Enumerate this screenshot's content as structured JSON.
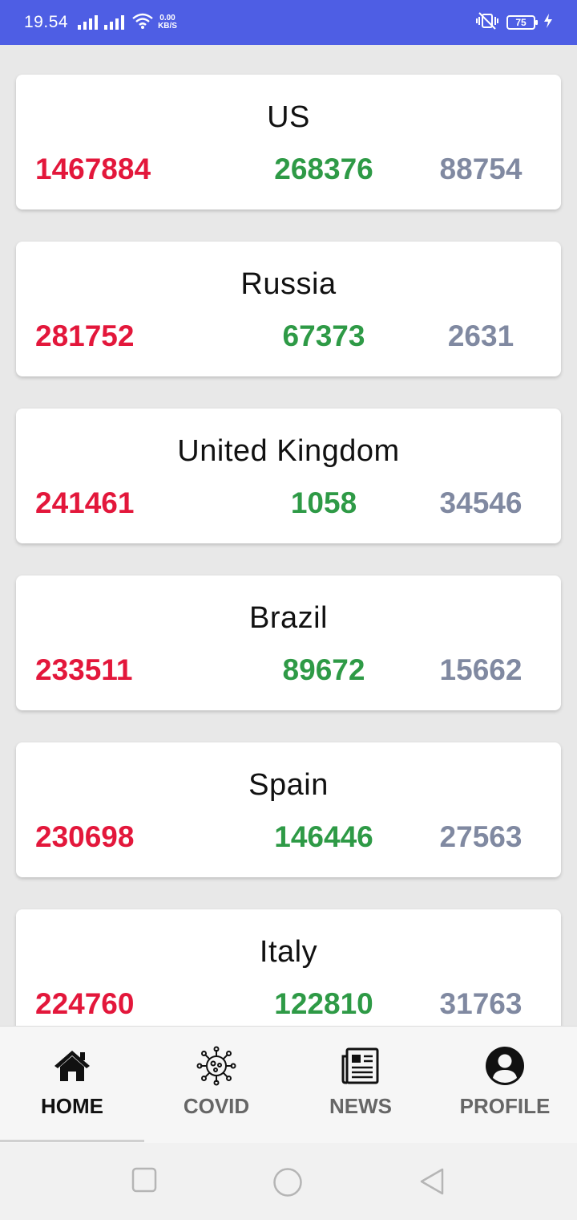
{
  "status_bar": {
    "time": "19.54",
    "net_speed_value": "0.00",
    "net_speed_unit": "KB/S",
    "battery": "75",
    "icons": [
      "signal-icon",
      "signal-icon",
      "wifi-icon",
      "vibrate-off-icon",
      "battery-icon",
      "charging-icon"
    ]
  },
  "countries": [
    {
      "name": "US",
      "confirmed": "1467884",
      "recovered": "268376",
      "deaths": "88754"
    },
    {
      "name": "Russia",
      "confirmed": "281752",
      "recovered": "67373",
      "deaths": "2631"
    },
    {
      "name": "United Kingdom",
      "confirmed": "241461",
      "recovered": "1058",
      "deaths": "34546"
    },
    {
      "name": "Brazil",
      "confirmed": "233511",
      "recovered": "89672",
      "deaths": "15662"
    },
    {
      "name": "Spain",
      "confirmed": "230698",
      "recovered": "146446",
      "deaths": "27563"
    },
    {
      "name": "Italy",
      "confirmed": "224760",
      "recovered": "122810",
      "deaths": "31763"
    }
  ],
  "colors": {
    "status_bar": "#4e5ee4",
    "confirmed": "#e3173b",
    "recovered": "#2e9a46",
    "deaths": "#8089a1"
  },
  "bottom_nav": {
    "active": "home",
    "items": [
      {
        "label": "HOME",
        "icon": "home-icon"
      },
      {
        "label": "COVID",
        "icon": "virus-icon"
      },
      {
        "label": "NEWS",
        "icon": "newspaper-icon"
      },
      {
        "label": "PROFILE",
        "icon": "profile-icon"
      }
    ]
  },
  "system_nav": {
    "icons": [
      "recents-icon",
      "home-circle-icon",
      "back-icon"
    ]
  }
}
